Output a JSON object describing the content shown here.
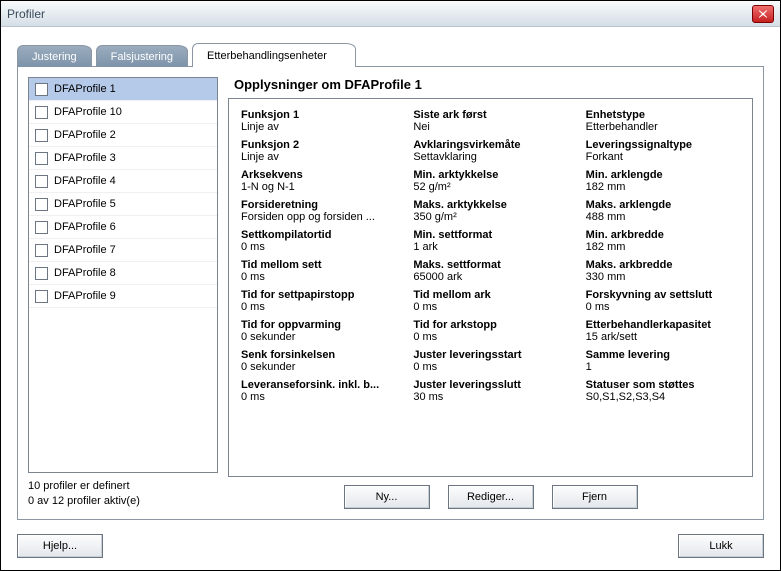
{
  "window": {
    "title": "Profiler"
  },
  "tabs": {
    "justering": "Justering",
    "falsjustering": "Falsjustering",
    "etterbehandling": "Etterbehandlingsenheter"
  },
  "profiles": [
    {
      "name": "DFAProfile 1",
      "selected": true,
      "checked": false
    },
    {
      "name": "DFAProfile 10",
      "selected": false,
      "checked": false
    },
    {
      "name": "DFAProfile 2",
      "selected": false,
      "checked": false
    },
    {
      "name": "DFAProfile 3",
      "selected": false,
      "checked": false
    },
    {
      "name": "DFAProfile 4",
      "selected": false,
      "checked": false
    },
    {
      "name": "DFAProfile 5",
      "selected": false,
      "checked": false
    },
    {
      "name": "DFAProfile 6",
      "selected": false,
      "checked": false
    },
    {
      "name": "DFAProfile 7",
      "selected": false,
      "checked": false
    },
    {
      "name": "DFAProfile 8",
      "selected": false,
      "checked": false
    },
    {
      "name": "DFAProfile 9",
      "selected": false,
      "checked": false
    }
  ],
  "status": {
    "line1": "10 profiler er definert",
    "line2": "0 av 12 profiler aktiv(e)"
  },
  "detail_title": "Opplysninger om DFAProfile 1",
  "details": {
    "col1": [
      {
        "label": "Funksjon 1",
        "value": "Linje av"
      },
      {
        "label": "Funksjon 2",
        "value": "Linje av"
      },
      {
        "label": "Arksekvens",
        "value": "1-N og N-1"
      },
      {
        "label": "Forsideretning",
        "value": "Forsiden opp og forsiden ..."
      },
      {
        "label": "Settkompilatortid",
        "value": "0 ms"
      },
      {
        "label": "Tid mellom sett",
        "value": "0 ms"
      },
      {
        "label": "Tid for settpapirstopp",
        "value": "0 ms"
      },
      {
        "label": "Tid for oppvarming",
        "value": "0 sekunder"
      },
      {
        "label": "Senk forsinkelsen",
        "value": "0 sekunder"
      },
      {
        "label": "Leveranseforsink. inkl. b...",
        "value": "0 ms"
      }
    ],
    "col2": [
      {
        "label": "Siste ark først",
        "value": "Nei"
      },
      {
        "label": "Avklaringsvirkemåte",
        "value": "Settavklaring"
      },
      {
        "label": "Min. arktykkelse",
        "value": "52 g/m²"
      },
      {
        "label": "Maks. arktykkelse",
        "value": "350 g/m²"
      },
      {
        "label": "Min. settformat",
        "value": "1 ark"
      },
      {
        "label": "Maks. settformat",
        "value": "65000 ark"
      },
      {
        "label": "Tid mellom ark",
        "value": "0 ms"
      },
      {
        "label": "Tid for arkstopp",
        "value": "0 ms"
      },
      {
        "label": "Juster leveringsstart",
        "value": "0 ms"
      },
      {
        "label": "Juster leveringsslutt",
        "value": "30 ms"
      }
    ],
    "col3": [
      {
        "label": "Enhetstype",
        "value": "Etterbehandler"
      },
      {
        "label": "Leveringssignaltype",
        "value": "Forkant"
      },
      {
        "label": "Min. arklengde",
        "value": "182 mm"
      },
      {
        "label": "Maks. arklengde",
        "value": "488 mm"
      },
      {
        "label": "Min. arkbredde",
        "value": "182 mm"
      },
      {
        "label": "Maks. arkbredde",
        "value": "330 mm"
      },
      {
        "label": "Forskyvning av settslutt",
        "value": "0 ms"
      },
      {
        "label": "Etterbehandlerkapasitet",
        "value": "15 ark/sett"
      },
      {
        "label": "Samme levering",
        "value": "1"
      },
      {
        "label": "Statuser som støttes",
        "value": "S0,S1,S2,S3,S4"
      }
    ]
  },
  "buttons": {
    "ny": "Ny...",
    "rediger": "Rediger...",
    "fjern": "Fjern",
    "hjelp": "Hjelp...",
    "lukk": "Lukk"
  }
}
